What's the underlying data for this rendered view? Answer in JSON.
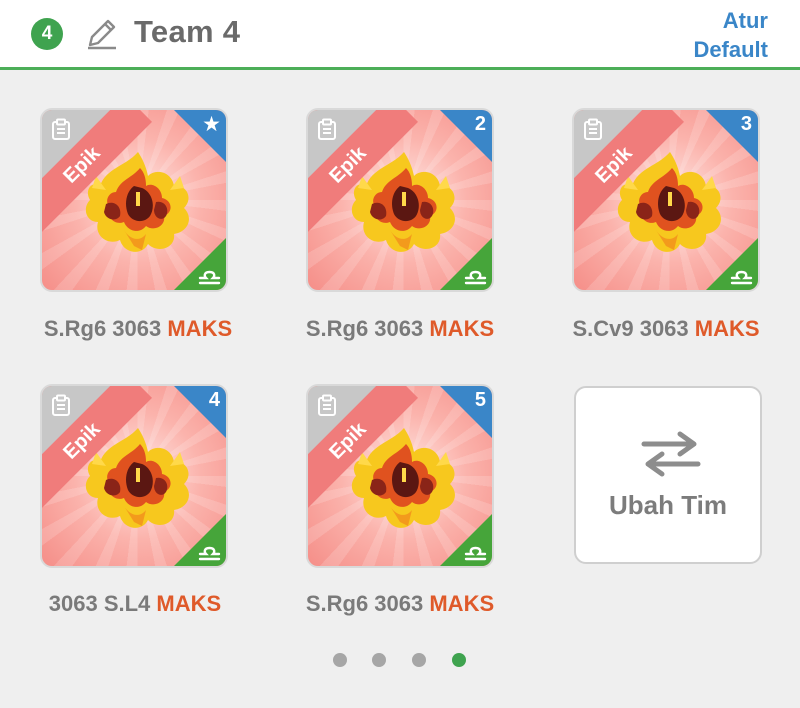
{
  "header": {
    "team_number": "4",
    "team_name": "Team 4",
    "atur_label": "Atur",
    "default_label": "Default",
    "icons": {
      "edit": "pencil-icon"
    }
  },
  "cards": [
    {
      "rarity": "Epik",
      "corner": "★",
      "corner_type": "star",
      "name_parts": [
        "S.Rg6 3063 ",
        "MAKS"
      ]
    },
    {
      "rarity": "Epik",
      "corner": "2",
      "corner_type": "number",
      "name_parts": [
        "S.Rg6 3063 ",
        "MAKS"
      ]
    },
    {
      "rarity": "Epik",
      "corner": "3",
      "corner_type": "number",
      "name_parts": [
        "S.Cv9 3063 ",
        "MAKS"
      ]
    },
    {
      "rarity": "Epik",
      "corner": "4",
      "corner_type": "number",
      "name_parts": [
        "3063 S.L4 ",
        "MAKS"
      ]
    },
    {
      "rarity": "Epik",
      "corner": "5",
      "corner_type": "number",
      "name_parts": [
        "S.Rg6 3063 ",
        "MAKS"
      ]
    }
  ],
  "switch_team": {
    "label": "Ubah Tim",
    "icon": "swap-arrows-icon"
  },
  "pagination": {
    "total": 4,
    "active": 4
  },
  "colors": {
    "accent_green": "#3fa34f",
    "link_blue": "#3a86c8",
    "maks_orange": "#df5a2a",
    "rarity_ribbon": "#f07c7b",
    "element_corner": "#46a53a"
  }
}
